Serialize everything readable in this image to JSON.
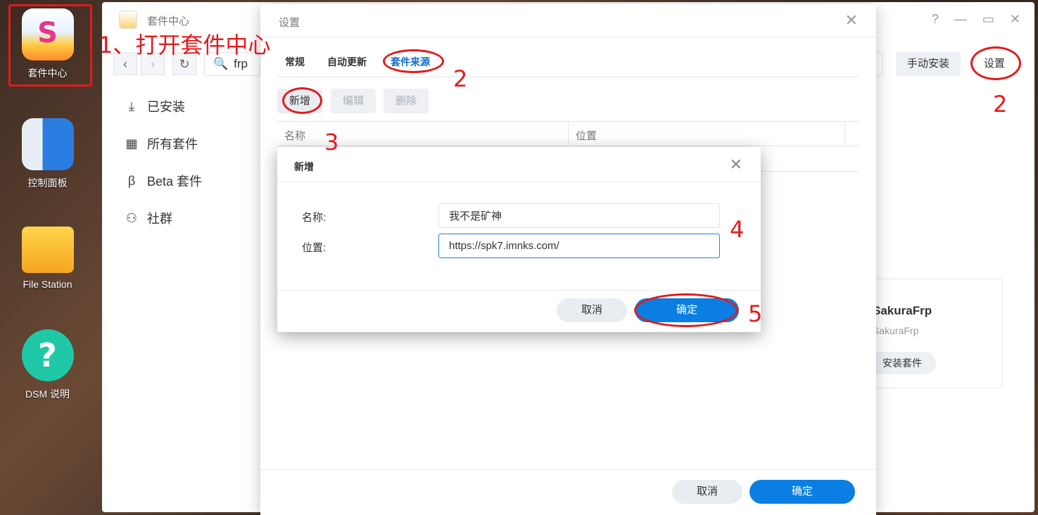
{
  "desktop": {
    "icons": [
      {
        "label": "套件中心",
        "icon": "package-center-icon"
      },
      {
        "label": "控制面板",
        "icon": "control-panel-icon"
      },
      {
        "label": "File Station",
        "icon": "folder-icon"
      },
      {
        "label": "DSM 说明",
        "icon": "help-icon"
      }
    ]
  },
  "annotations": {
    "step1": "1、打开套件中心",
    "step2_tab": "2",
    "step2_settings": "2",
    "step3": "3",
    "step4": "4",
    "step5": "5",
    "color": "#e21b1b"
  },
  "main_window": {
    "title": "套件中心",
    "search_value": "frp",
    "manual_install": "手动安装",
    "settings": "设置",
    "sidebar": [
      {
        "label": "已安装",
        "icon": "download-icon"
      },
      {
        "label": "所有套件",
        "icon": "grid-icon"
      },
      {
        "label": "Beta 套件",
        "icon": "beta-icon"
      },
      {
        "label": "社群",
        "icon": "community-icon"
      }
    ],
    "card": {
      "name": "SakuraFrp",
      "publisher": "SakuraFrp",
      "install_button": "安装套件"
    }
  },
  "settings_dialog": {
    "title": "设置",
    "tabs": [
      "常规",
      "自动更新",
      "套件来源"
    ],
    "active_tab": "套件来源",
    "toolbar": {
      "add": "新增",
      "edit": "编辑",
      "delete": "删除"
    },
    "columns": [
      "名称",
      "位置"
    ],
    "footer": {
      "cancel": "取消",
      "ok": "确定"
    }
  },
  "add_dialog": {
    "title": "新增",
    "name_label": "名称:",
    "name_value": "我不是矿神",
    "location_label": "位置:",
    "location_value": "https://spk7.imnks.com/",
    "cancel": "取消",
    "ok": "确定"
  },
  "colors": {
    "primary": "#0a7ee2",
    "active_tab": "#0a6ed1",
    "annotation_red": "#e21b1b"
  }
}
